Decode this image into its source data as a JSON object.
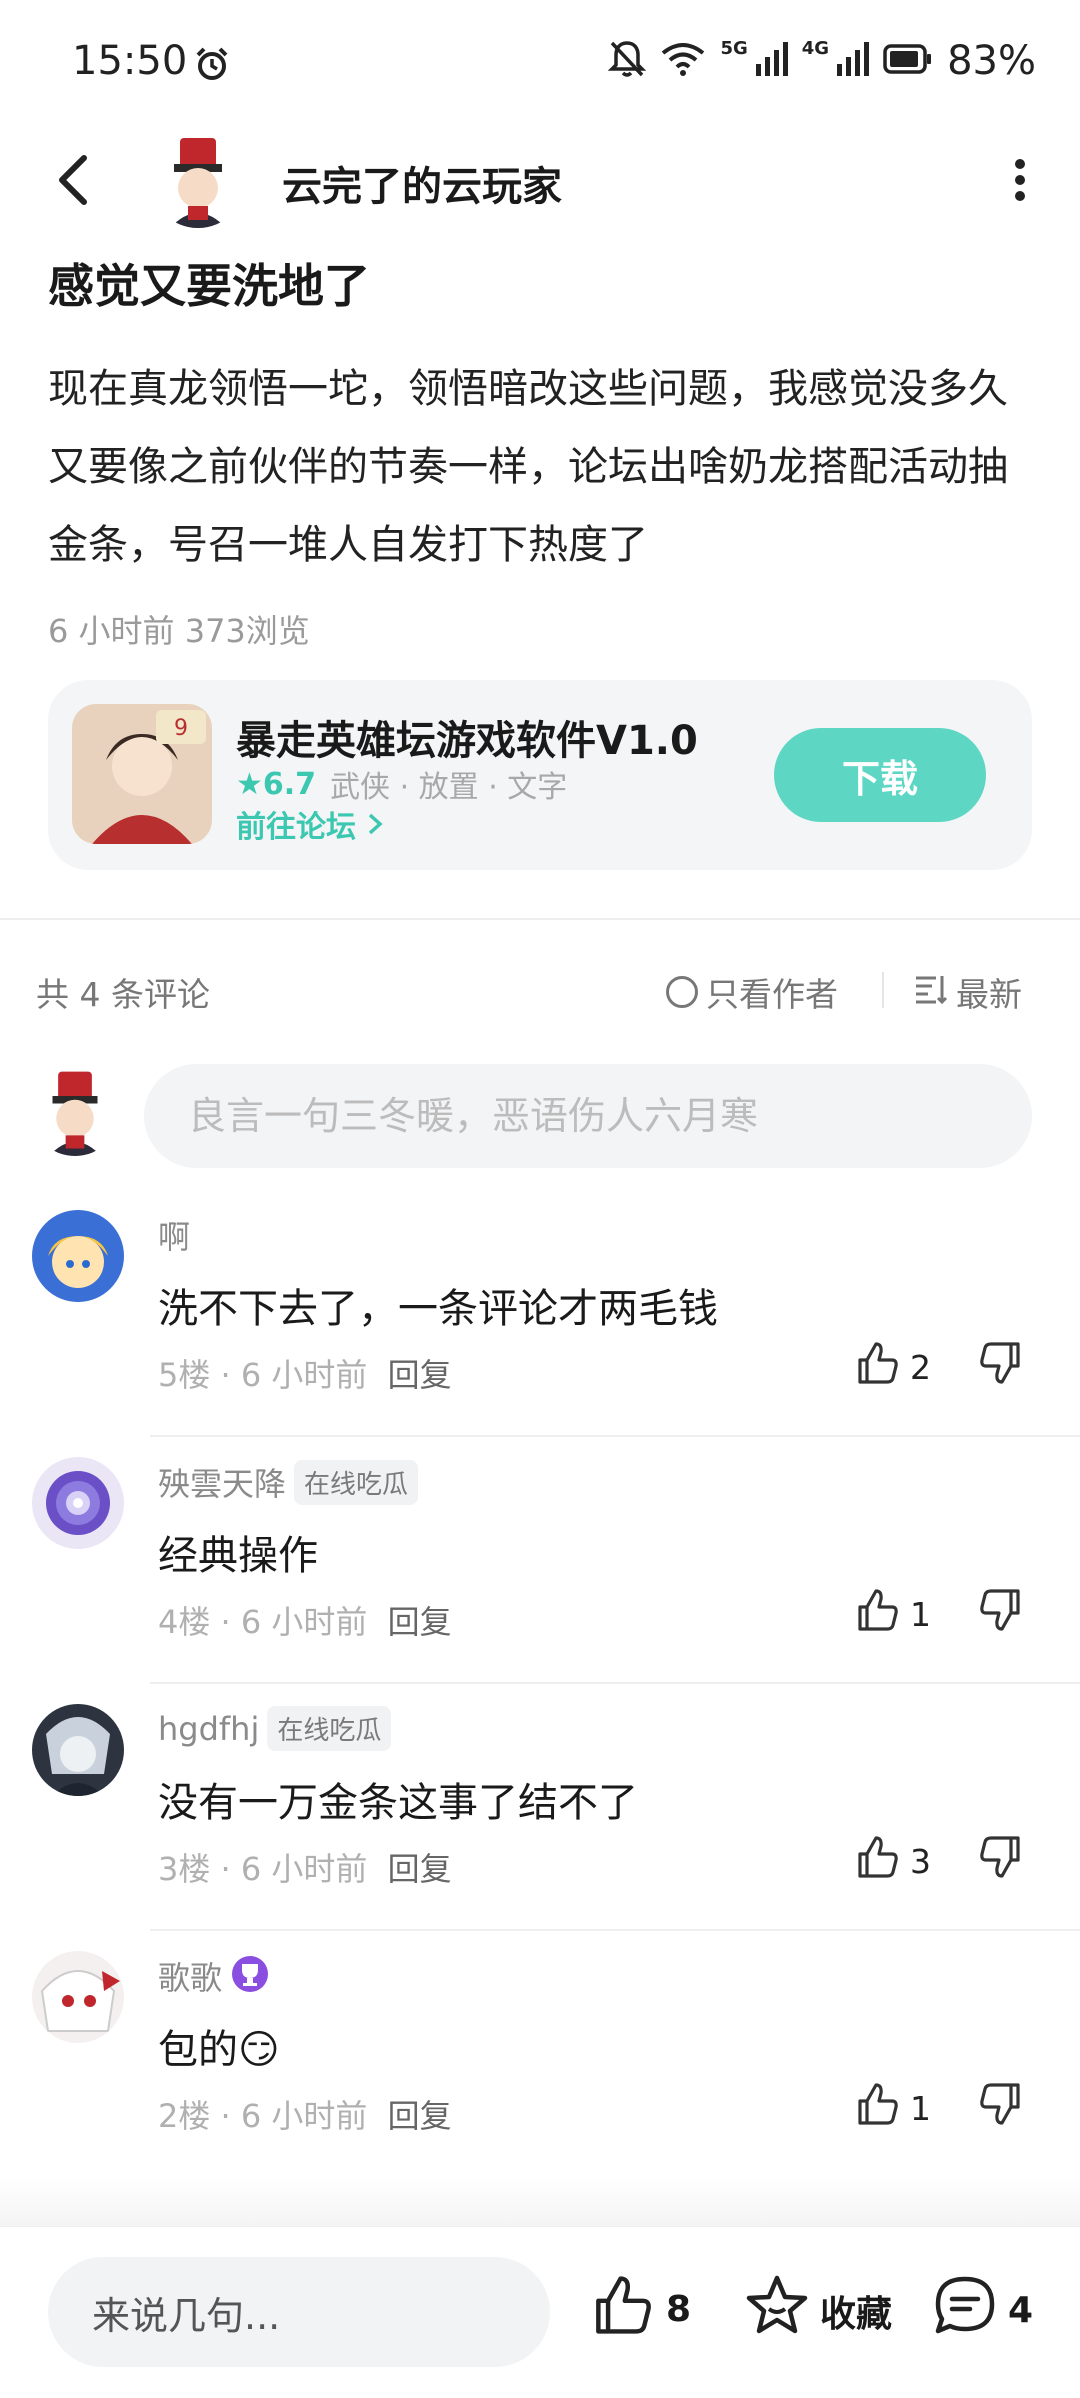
{
  "status_bar": {
    "time": "15:50",
    "network_5g": "5G",
    "network_4g": "4G",
    "battery": "83%"
  },
  "header": {
    "author_name": "云完了的云玩家"
  },
  "post": {
    "title": "感觉又要洗地了",
    "body": "现在真龙领悟一坨，领悟暗改这些问题，我感觉没多久又要像之前伙伴的节奏一样，论坛出啥奶龙搭配活动抽金条，号召一堆人自发打下热度了",
    "meta": "6 小时前  373浏览"
  },
  "game_card": {
    "name": "暴走英雄坛游戏软件V1.0",
    "rating": "6.7",
    "tags": "武侠 · 放置 · 文字",
    "forum_link": "前往论坛",
    "download_label": "下载"
  },
  "comments_header": {
    "count_label": "共 4 条评论",
    "only_author_label": "只看作者",
    "sort_label": "最新"
  },
  "compose": {
    "placeholder": "良言一句三冬暖，恶语伤人六月寒"
  },
  "comments": [
    {
      "name": "啊",
      "badge": "",
      "text": "洗不下去了，一条评论才两毛钱",
      "floor": "5楼 · 6 小时前",
      "reply": "回复",
      "likes": "2"
    },
    {
      "name": "殃雲天降",
      "badge": "在线吃瓜",
      "text": "经典操作",
      "floor": "4楼 · 6 小时前",
      "reply": "回复",
      "likes": "1"
    },
    {
      "name": "hgdfhj",
      "badge": "在线吃瓜",
      "text": "没有一万金条这事了结不了",
      "floor": "3楼 · 6 小时前",
      "reply": "回复",
      "likes": "3"
    },
    {
      "name": "歌歌",
      "badge": "",
      "text": "包的😏",
      "floor": "2楼 · 6 小时前",
      "reply": "回复",
      "likes": "1"
    }
  ],
  "bottom_bar": {
    "input_label": "来说几句...",
    "like_count": "8",
    "favorite_label": "收藏",
    "comment_count": "4"
  },
  "colors": {
    "accent": "#5dd6c3",
    "accent_text": "#3cc7b1"
  }
}
